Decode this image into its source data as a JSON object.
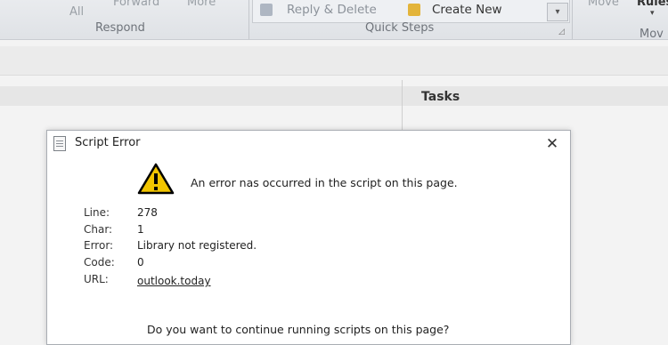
{
  "ribbon": {
    "top_items": [
      "All",
      "Forward",
      "More",
      "Move",
      "Rules"
    ],
    "groups": {
      "respond": "Respond",
      "quick_steps": "Quick Steps",
      "move": "Mov"
    },
    "quick_steps": {
      "reply_delete": "Reply & Delete",
      "create_new": "Create New"
    }
  },
  "pane": {
    "tasks_label": "Tasks"
  },
  "dialog": {
    "title": "Script Error",
    "close_glyph": "✕",
    "message": "An error nas occurred in the script on this page.",
    "fields": [
      {
        "label": "Line:",
        "value": "278"
      },
      {
        "label": "Char:",
        "value": "1"
      },
      {
        "label": "Error:",
        "value": "Library not registered."
      },
      {
        "label": "Code:",
        "value": "0"
      },
      {
        "label": "URL:",
        "value": "outlook.today"
      }
    ],
    "prompt": "Do you want to continue running scripts on this page?",
    "icons": {
      "warning": "warning-icon",
      "script": "script-icon"
    },
    "colors": {
      "warning_fill": "#f2c500",
      "warning_outline": "#000000"
    }
  }
}
